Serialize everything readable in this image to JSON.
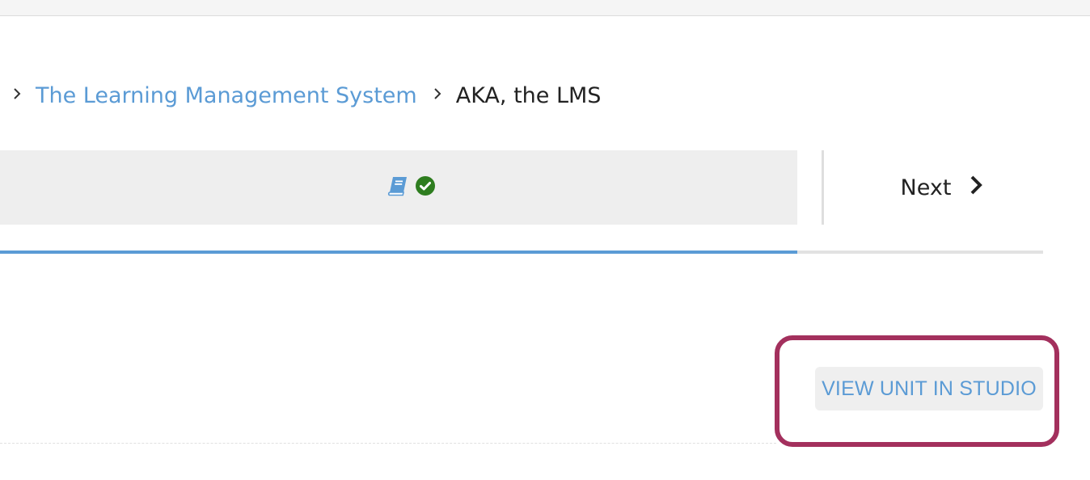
{
  "breadcrumb": {
    "separator": "›",
    "parent_label": "The Learning Management System",
    "current_label": "AKA, the LMS"
  },
  "sequence": {
    "unit_icon": "book-icon",
    "status_icon": "check-circle-icon",
    "colors": {
      "icon_blue": "#5b9bd5",
      "check_green": "#2e7d1f"
    }
  },
  "navigation": {
    "next_label": "Next",
    "next_icon": "chevron-right-icon"
  },
  "progress": {
    "fraction": 0.764,
    "fill_color": "#5b9bd5"
  },
  "studio": {
    "button_label": "VIEW UNIT IN STUDIO",
    "highlight_color": "#a3305d"
  }
}
